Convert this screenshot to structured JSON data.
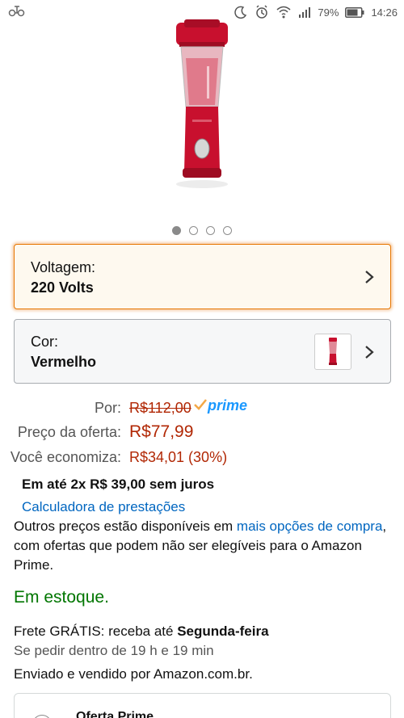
{
  "status_bar": {
    "battery": "79%",
    "time": "14:26",
    "icons": [
      "app-notification-icon",
      "do-not-disturb-icon",
      "alarm-icon",
      "wifi-icon",
      "signal-icon",
      "battery-icon"
    ]
  },
  "gallery": {
    "image_count": 4,
    "active_index": 0
  },
  "variations": {
    "voltage_label": "Voltagem:",
    "voltage_value": "220 Volts",
    "color_label": "Cor:",
    "color_value": "Vermelho"
  },
  "price": {
    "list_label": "Por:",
    "list_price": "R$112,00",
    "prime_label": "prime",
    "deal_label": "Preço da oferta:",
    "deal_price": "R$77,99",
    "savings_label": "Você economiza:",
    "savings_value": "R$34,01 (30%)"
  },
  "installments": "Em até 2x R$ 39,00 sem juros",
  "calculator_link": "Calculadora de prestações",
  "other_prices": {
    "text_before": "Outros preços estão disponíveis em ",
    "link": "mais opções de compra",
    "text_after": ", com ofertas que podem não ser elegíveis para o Amazon Prime."
  },
  "stock": "Em estoque.",
  "delivery": {
    "text": "Frete GRÁTIS: receba até ",
    "day": "Segunda-feira"
  },
  "cutoff": "Se pedir dentro de 19 h e 19 min",
  "sold_by": "Enviado e vendido por Amazon.com.br.",
  "prime_offer_title": "Oferta Prime",
  "colors": {
    "accent_orange": "#e77600",
    "price_red": "#b12704",
    "link_blue": "#0066c0",
    "stock_green": "#007600",
    "prime_blue": "#1a98ff"
  }
}
